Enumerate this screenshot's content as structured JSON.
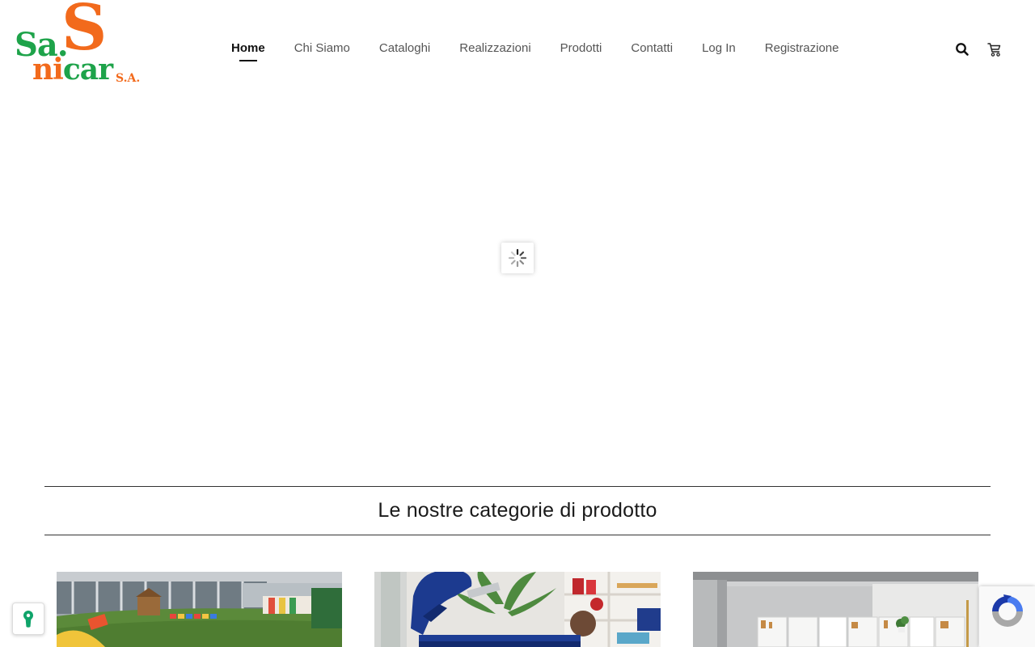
{
  "logo": {
    "alt": "Sa.Sanicar S.A.",
    "big_s": "S",
    "line1": "Sa.",
    "line2_a": "ni",
    "line2_b": "car",
    "suffix": "S.A."
  },
  "nav": {
    "items": [
      {
        "label": "Home",
        "active": true
      },
      {
        "label": "Chi Siamo"
      },
      {
        "label": "Cataloghi"
      },
      {
        "label": "Realizzazioni"
      },
      {
        "label": "Prodotti"
      },
      {
        "label": "Contatti"
      },
      {
        "label": "Log In"
      },
      {
        "label": "Registrazione"
      }
    ]
  },
  "header_icons": {
    "search": "search-icon",
    "cart": "cart-icon"
  },
  "hero": {
    "state": "loading",
    "spinner": "spinner-icon"
  },
  "categories": {
    "title": "Le nostre categorie di prodotto",
    "items": [
      {
        "image": "playground-photo"
      },
      {
        "image": "physiotherapy-room-photo"
      },
      {
        "image": "office-interior-photo"
      }
    ]
  },
  "widgets": {
    "cookie_icon": "keyhole-icon",
    "recaptcha_icon": "recaptcha-icon"
  },
  "colors": {
    "brand_orange": "#f26a1c",
    "brand_green": "#1ea34a",
    "nav_text": "#555555",
    "nav_active": "#111111",
    "cookie_accent": "#0fa46a"
  }
}
